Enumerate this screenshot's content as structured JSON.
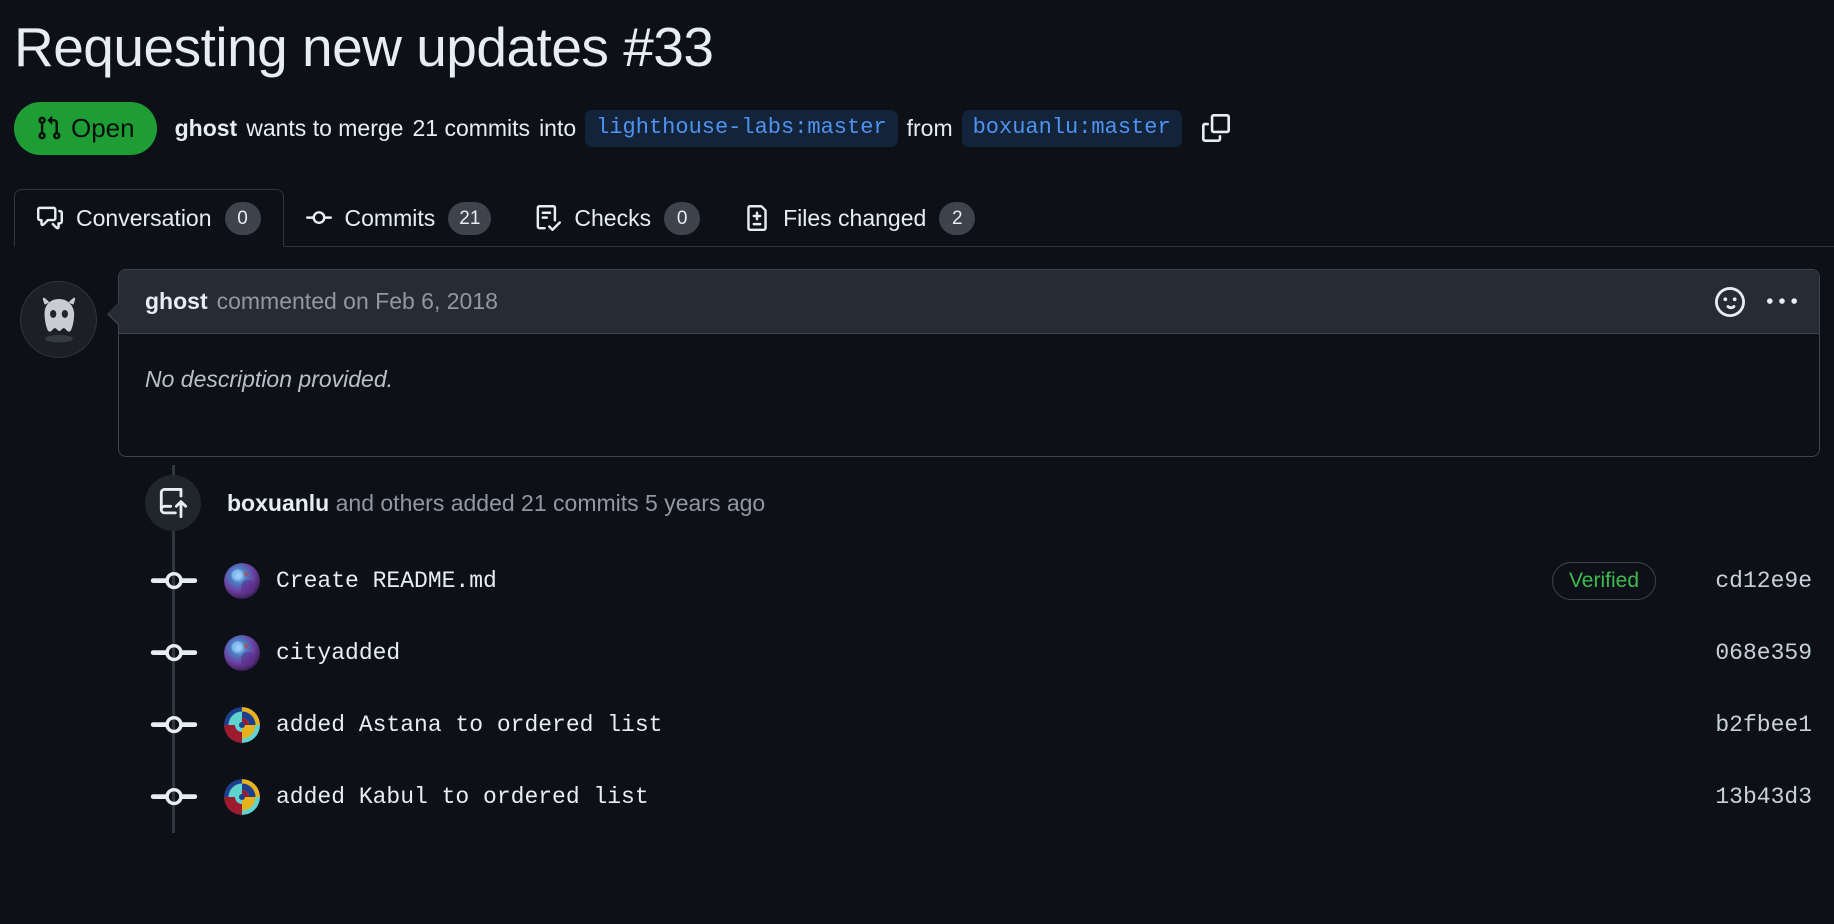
{
  "pull_request": {
    "title": "Requesting new updates",
    "number": "#33",
    "state_label": "Open",
    "state_color": "#1f9d35",
    "author": "ghost",
    "action_text_before": "wants to merge",
    "commit_count_text": "21 commits",
    "action_text_middle": "into",
    "base_branch": "lighthouse-labs:master",
    "action_text_after": "from",
    "head_branch": "boxuanlu:master",
    "copy_icon": "copy-icon"
  },
  "tabs": [
    {
      "id": "conversation",
      "label": "Conversation",
      "count": "0",
      "icon": "comment-discussion-icon",
      "active": true
    },
    {
      "id": "commits",
      "label": "Commits",
      "count": "21",
      "icon": "git-commit-icon",
      "active": false
    },
    {
      "id": "checks",
      "label": "Checks",
      "count": "0",
      "icon": "checklist-icon",
      "active": false
    },
    {
      "id": "files",
      "label": "Files changed",
      "count": "2",
      "icon": "file-diff-icon",
      "active": false
    }
  ],
  "comment": {
    "avatar": "ghost-avatar",
    "author": "ghost",
    "meta": "commented on Feb 6, 2018",
    "body": "No description provided.",
    "reaction_icon": "smiley-icon",
    "menu_icon": "kebab-horizontal-icon"
  },
  "commits_event": {
    "icon": "repo-push-icon",
    "author": "boxuanlu",
    "text": "and others added 21 commits 5 years ago"
  },
  "commits": [
    {
      "avatar": "avatar-nebula",
      "message": "Create README.md",
      "verified": "Verified",
      "sha": "cd12e9e"
    },
    {
      "avatar": "avatar-nebula",
      "message": "cityadded",
      "verified": null,
      "sha": "068e359"
    },
    {
      "avatar": "avatar-spiral",
      "message": "added Astana to ordered list",
      "verified": null,
      "sha": "b2fbee1"
    },
    {
      "avatar": "avatar-spiral",
      "message": "added Kabul to ordered list",
      "verified": null,
      "sha": "13b43d3"
    }
  ],
  "colors": {
    "background": "#0d1117",
    "border": "#30363d",
    "header_bg": "#262c36",
    "accent_green": "#1f9d35",
    "verified_green": "#3fb950",
    "branch_text": "#4e93f0",
    "branch_bg": "#132339",
    "muted_text": "#9198a1"
  }
}
